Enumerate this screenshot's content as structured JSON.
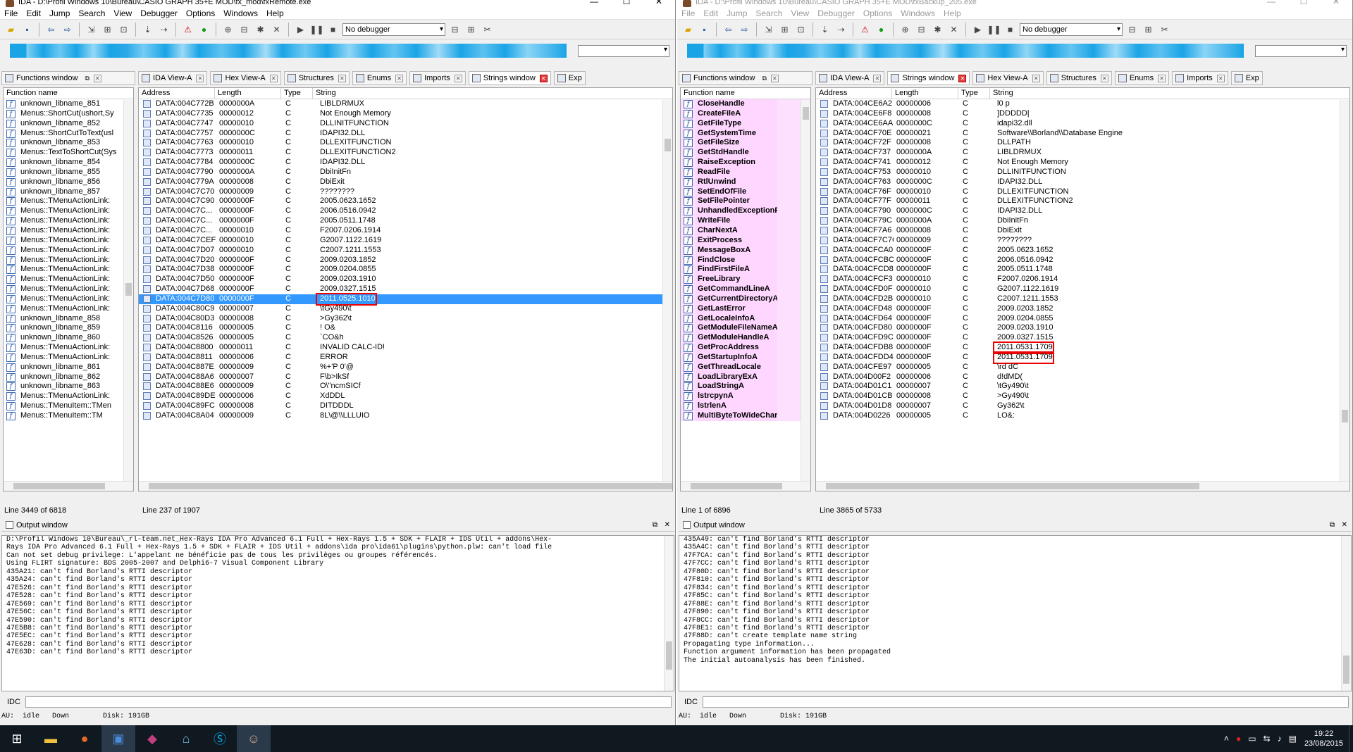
{
  "left": {
    "title": "IDA - D:\\Profil Windows 10\\Bureau\\CASIO GRAPH 35+E MOD\\fx_mod\\fxRemote.exe",
    "menu": [
      "File",
      "Edit",
      "Jump",
      "Search",
      "View",
      "Debugger",
      "Options",
      "Windows",
      "Help"
    ],
    "debugger": "No debugger",
    "tabs": [
      {
        "label": "Functions window",
        "type": "func"
      },
      {
        "label": "IDA View-A"
      },
      {
        "label": "Hex View-A"
      },
      {
        "label": "Structures"
      },
      {
        "label": "Enums"
      },
      {
        "label": "Imports"
      },
      {
        "label": "Strings window",
        "active": true
      },
      {
        "label": "Exp"
      }
    ],
    "functions_header": "Function name",
    "functions": [
      "unknown_libname_851",
      "Menus::ShortCut(ushort,Sy",
      "unknown_libname_852",
      "Menus::ShortCutToText(usl",
      "unknown_libname_853",
      "Menus::TextToShortCut(Sys",
      "unknown_libname_854",
      "unknown_libname_855",
      "unknown_libname_856",
      "unknown_libname_857",
      "Menus::TMenuActionLink:",
      "Menus::TMenuActionLink:",
      "Menus::TMenuActionLink:",
      "Menus::TMenuActionLink:",
      "Menus::TMenuActionLink:",
      "Menus::TMenuActionLink:",
      "Menus::TMenuActionLink:",
      "Menus::TMenuActionLink:",
      "Menus::TMenuActionLink:",
      "Menus::TMenuActionLink:",
      "Menus::TMenuActionLink:",
      "Menus::TMenuActionLink:",
      "unknown_libname_858",
      "unknown_libname_859",
      "unknown_libname_860",
      "Menus::TMenuActionLink:",
      "Menus::TMenuActionLink:",
      "unknown_libname_861",
      "unknown_libname_862",
      "unknown_libname_863",
      "Menus::TMenuActionLink:",
      "Menus::TMenuItem::TMen",
      "Menus::TMenuItem::TM"
    ],
    "strings_headers": [
      "Address",
      "Length",
      "Type",
      "String"
    ],
    "strings": [
      [
        "DATA:004C772B",
        "0000000A",
        "C",
        "LIBLDRMUX"
      ],
      [
        "DATA:004C7735",
        "00000012",
        "C",
        "Not Enough Memory"
      ],
      [
        "DATA:004C7747",
        "00000010",
        "C",
        "DLLINITFUNCTION"
      ],
      [
        "DATA:004C7757",
        "0000000C",
        "C",
        "IDAPI32.DLL"
      ],
      [
        "DATA:004C7763",
        "00000010",
        "C",
        "DLLEXITFUNCTION"
      ],
      [
        "DATA:004C7773",
        "00000011",
        "C",
        "DLLEXITFUNCTION2"
      ],
      [
        "DATA:004C7784",
        "0000000C",
        "C",
        "IDAPI32.DLL"
      ],
      [
        "DATA:004C7790",
        "0000000A",
        "C",
        "DbiInitFn"
      ],
      [
        "DATA:004C779A",
        "00000008",
        "C",
        "DbiExit"
      ],
      [
        "DATA:004C7C70",
        "00000009",
        "C",
        "????????"
      ],
      [
        "DATA:004C7C90",
        "0000000F",
        "C",
        "2005.0623.1652"
      ],
      [
        "DATA:004C7C...",
        "0000000F",
        "C",
        "2006.0516.0942"
      ],
      [
        "DATA:004C7C...",
        "0000000F",
        "C",
        "2005.0511.1748"
      ],
      [
        "DATA:004C7C...",
        "00000010",
        "C",
        "F2007.0206.1914"
      ],
      [
        "DATA:004C7CEF",
        "00000010",
        "C",
        "G2007.1122.1619"
      ],
      [
        "DATA:004C7D07",
        "00000010",
        "C",
        "C2007.1211.1553"
      ],
      [
        "DATA:004C7D20",
        "0000000F",
        "C",
        "2009.0203.1852"
      ],
      [
        "DATA:004C7D38",
        "0000000F",
        "C",
        "2009.0204.0855"
      ],
      [
        "DATA:004C7D50",
        "0000000F",
        "C",
        "2009.0203.1910"
      ],
      [
        "DATA:004C7D68",
        "0000000F",
        "C",
        "2009.0327.1515"
      ],
      [
        "DATA:004C7D80",
        "0000000F",
        "C",
        "2011.0525.1010"
      ],
      [
        "DATA:004C80C9",
        "00000007",
        "C",
        "\\tGy490\\t"
      ],
      [
        "DATA:004C80D3",
        "00000008",
        "C",
        ">Gy362\\t"
      ],
      [
        "DATA:004C8116",
        "00000005",
        "C",
        "! O&"
      ],
      [
        "DATA:004C8526",
        "00000005",
        "C",
        "`CO&h"
      ],
      [
        "DATA:004C8800",
        "00000011",
        "C",
        "INVALID CALC-ID!"
      ],
      [
        "DATA:004C8811",
        "00000006",
        "C",
        "ERROR"
      ],
      [
        "DATA:004C887E",
        "00000009",
        "C",
        "%+'P 0'@"
      ],
      [
        "DATA:004C88A6",
        "00000007",
        "C",
        "F\\b>IkSf"
      ],
      [
        "DATA:004C88E6",
        "00000009",
        "C",
        "O\\\"ncmSICf"
      ],
      [
        "DATA:004C89DE",
        "00000006",
        "C",
        "XdDDL"
      ],
      [
        "DATA:004C89FC",
        "00000008",
        "C",
        "DITDDDL"
      ],
      [
        "DATA:004C8A04",
        "00000009",
        "C",
        "8L\\@\\\\LLLUIO"
      ]
    ],
    "selected_row": 20,
    "highlight_rows": [
      20
    ],
    "func_status": "Line 3449 of 6818",
    "str_status": "Line 237 of 1907",
    "output_title": "Output window",
    "output": [
      "D:\\Profil Windows 10\\Bureau\\_rl-team.net_Hex-Rays IDA Pro Advanced 6.1 Full + Hex-Rays 1.5 + SDK + FLAIR + IDS Util + addons\\Hex-",
      "Rays IDA Pro Advanced 6.1 Full + Hex-Rays 1.5 + SDK + FLAIR + IDS Util + addons\\ida pro\\ida61\\plugins\\python.plw: can't load file",
      "Can not set debug privilege: L'appelant ne bénéficie pas de tous les privilèges ou groupes référencés.",
      "Using FLIRT signature: BDS 2005-2007 and Delphi6-7 Visual Component Library",
      "435A21: can't find Borland's RTTI descriptor",
      "435A24: can't find Borland's RTTI descriptor",
      "47E526: can't find Borland's RTTI descriptor",
      "47E528: can't find Borland's RTTI descriptor",
      "47E569: can't find Borland's RTTI descriptor",
      "47E56C: can't find Borland's RTTI descriptor",
      "47E590: can't find Borland's RTTI descriptor",
      "47E5B8: can't find Borland's RTTI descriptor",
      "47E5EC: can't find Borland's RTTI descriptor",
      "47E628: can't find Borland's RTTI descriptor",
      "47E63D: can't find Borland's RTTI descriptor"
    ],
    "idc_label": "IDC",
    "status": "AU:  idle   Down        Disk: 191GB"
  },
  "right": {
    "title": "IDA - D:\\Profil Windows 10\\Bureau\\CASIO GRAPH 35+E MOD\\fxBackup_205.exe",
    "menu": [
      "File",
      "Edit",
      "Jump",
      "Search",
      "View",
      "Debugger",
      "Options",
      "Windows",
      "Help"
    ],
    "debugger": "No debugger",
    "tabs": [
      {
        "label": "Functions window",
        "type": "func"
      },
      {
        "label": "IDA View-A"
      },
      {
        "label": "Strings window",
        "active": true
      },
      {
        "label": "Hex View-A"
      },
      {
        "label": "Structures"
      },
      {
        "label": "Enums"
      },
      {
        "label": "Imports"
      },
      {
        "label": "Exp"
      }
    ],
    "functions_header": "Function name",
    "functions": [
      "CloseHandle",
      "CreateFileA",
      "GetFileType",
      "GetSystemTime",
      "GetFileSize",
      "GetStdHandle",
      "RaiseException",
      "ReadFile",
      "RtlUnwind",
      "SetEndOfFile",
      "SetFilePointer",
      "UnhandledExceptionFilter",
      "WriteFile",
      "CharNextA",
      "ExitProcess",
      "MessageBoxA",
      "FindClose",
      "FindFirstFileA",
      "FreeLibrary",
      "GetCommandLineA",
      "GetCurrentDirectoryA",
      "GetLastError",
      "GetLocaleInfoA",
      "GetModuleFileNameA",
      "GetModuleHandleA",
      "GetProcAddress",
      "GetStartupInfoA",
      "GetThreadLocale",
      "LoadLibraryExA",
      "LoadStringA",
      "lstrcpynA",
      "lstrlenA",
      "MultiByteToWideChar"
    ],
    "strings_headers": [
      "Address",
      "Length",
      "Type",
      "String"
    ],
    "strings": [
      [
        "DATA:004CE6A2",
        "00000006",
        "C",
        "l0 p"
      ],
      [
        "DATA:004CE6F8",
        "00000008",
        "C",
        "]DDDDD|"
      ],
      [
        "DATA:004CE6AA",
        "0000000C",
        "C",
        "idapi32.dll"
      ],
      [
        "DATA:004CF70E",
        "00000021",
        "C",
        "Software\\\\Borland\\\\Database Engine"
      ],
      [
        "DATA:004CF72F",
        "00000008",
        "C",
        "DLLPATH"
      ],
      [
        "DATA:004CF737",
        "0000000A",
        "C",
        "LIBLDRMUX"
      ],
      [
        "DATA:004CF741",
        "00000012",
        "C",
        "Not Enough Memory"
      ],
      [
        "DATA:004CF753",
        "00000010",
        "C",
        "DLLINITFUNCTION"
      ],
      [
        "DATA:004CF763",
        "0000000C",
        "C",
        "IDAPI32.DLL"
      ],
      [
        "DATA:004CF76F",
        "00000010",
        "C",
        "DLLEXITFUNCTION"
      ],
      [
        "DATA:004CF77F",
        "00000011",
        "C",
        "DLLEXITFUNCTION2"
      ],
      [
        "DATA:004CF790",
        "0000000C",
        "C",
        "IDAPI32.DLL"
      ],
      [
        "DATA:004CF79C",
        "0000000A",
        "C",
        "DbiInitFn"
      ],
      [
        "DATA:004CF7A6",
        "00000008",
        "C",
        "DbiExit"
      ],
      [
        "DATA:004CF7C7C",
        "00000009",
        "C",
        "????????"
      ],
      [
        "DATA:004CFCA0",
        "0000000F",
        "C",
        "2005.0623.1652"
      ],
      [
        "DATA:004CFCBC",
        "0000000F",
        "C",
        "2006.0516.0942"
      ],
      [
        "DATA:004CFCD8",
        "0000000F",
        "C",
        "2005.0511.1748"
      ],
      [
        "DATA:004CFCF3",
        "00000010",
        "C",
        "F2007.0206.1914"
      ],
      [
        "DATA:004CFD0F",
        "00000010",
        "C",
        "G2007.1122.1619"
      ],
      [
        "DATA:004CFD2B",
        "00000010",
        "C",
        "C2007.1211.1553"
      ],
      [
        "DATA:004CFD48",
        "0000000F",
        "C",
        "2009.0203.1852"
      ],
      [
        "DATA:004CFD64",
        "0000000F",
        "C",
        "2009.0204.0855"
      ],
      [
        "DATA:004CFD80",
        "0000000F",
        "C",
        "2009.0203.1910"
      ],
      [
        "DATA:004CFD9C",
        "0000000F",
        "C",
        "2009.0327.1515"
      ],
      [
        "DATA:004CFDB8",
        "0000000F",
        "C",
        "2011.0531.1709"
      ],
      [
        "DATA:004CFDD4",
        "0000000F",
        "C",
        "2011.0531.1709"
      ],
      [
        "DATA:004CFE97",
        "00000005",
        "C",
        "\\rd dC"
      ],
      [
        "DATA:004D00F2",
        "00000006",
        "C",
        "d!dMD("
      ],
      [
        "DATA:004D01C1",
        "00000007",
        "C",
        "\\tGy490\\t"
      ],
      [
        "DATA:004D01CB",
        "00000008",
        "C",
        ">Gy490\\t"
      ],
      [
        "DATA:004D01D8",
        "00000007",
        "C",
        "Gy362\\t"
      ],
      [
        "DATA:004D0226",
        "00000005",
        "C",
        "LO&:"
      ]
    ],
    "selected_row": -1,
    "highlight_rows": [
      25,
      26
    ],
    "func_status": "Line 1 of 6896",
    "str_status": "Line 3865 of 5733",
    "output_title": "Output window",
    "output": [
      "435A49: can't find Borland's RTTI descriptor",
      "435A4C: can't find Borland's RTTI descriptor",
      "47F7CA: can't find Borland's RTTI descriptor",
      "47F7CC: can't find Borland's RTTI descriptor",
      "47F80D: can't find Borland's RTTI descriptor",
      "47F810: can't find Borland's RTTI descriptor",
      "47F834: can't find Borland's RTTI descriptor",
      "47F85C: can't find Borland's RTTI descriptor",
      "47F88E: can't find Borland's RTTI descriptor",
      "47F890: can't find Borland's RTTI descriptor",
      "47F8CC: can't find Borland's RTTI descriptor",
      "47F8E1: can't find Borland's RTTI descriptor",
      "47F88D: can't create template name string",
      "Propagating type information...",
      "Function argument information has been propagated",
      "The initial autoanalysis has been finished."
    ],
    "idc_label": "IDC",
    "status": "AU:  idle   Down        Disk: 191GB"
  },
  "taskbar": {
    "time": "19:22",
    "date": "23/08/2015"
  }
}
